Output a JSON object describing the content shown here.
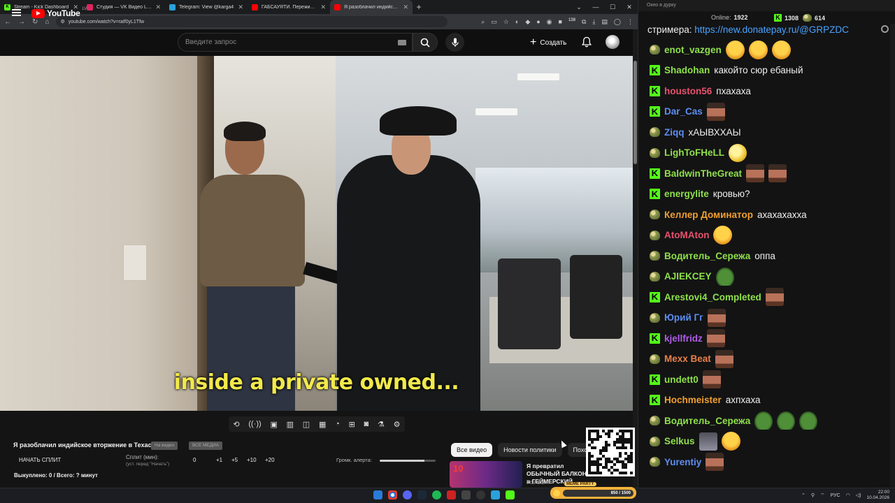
{
  "browser": {
    "tabs": [
      {
        "label": "Stream - Kick Dashboard",
        "fav_color": "#53fc18",
        "fav_text": "K"
      },
      {
        "label": "Студия — VK Видео Live",
        "fav_color": "#e0245e",
        "fav_text": ""
      },
      {
        "label": "Telegram: View @karga4",
        "fav_color": "#2aa1da",
        "fav_text": ""
      },
      {
        "label": "ГАБСАУЯТИ. Пережить индийск…",
        "fav_color": "#ff0000",
        "fav_text": ""
      },
      {
        "label": "Я разоблачил индийское…",
        "fav_color": "#ff0000",
        "fav_text": "",
        "active": true
      }
    ],
    "new_tab": "+",
    "url": "youtube.com/watch?v=raIf0yL1Tfw",
    "ext_badge": "138"
  },
  "youtube": {
    "logo_text": "YouTube",
    "country": "LV",
    "search_placeholder": "Введите запрос",
    "create_label": "Создать",
    "caption": "inside a private owned...",
    "video_title": "Я разоблачил индийское вторжение в Техас...",
    "pill_1": "На видео",
    "pill_2": "ВСЕ МЕДИА",
    "start_split": "НАЧАТЬ СПЛИТ",
    "split_label": "Сплит (мин):",
    "split_hint": "(уст. перед \"Начать\")",
    "split_value": "0",
    "inc": [
      "+1",
      "+5",
      "+10",
      "+20"
    ],
    "alert_volume": "Громк. алерта:",
    "alert_volume_level": 0.8,
    "totals": "Выкуплено: 0 / Всего: ? минут",
    "chips": [
      "Все видео",
      "Новости политики",
      "Похожие"
    ],
    "rec_number": "10",
    "rec_title": "Я превратил ОБЫЧНЫЙ БАЛКОН в ГЕЙМЕРСКИЙ",
    "rec_channel": "FISPECKT"
  },
  "chat": {
    "title": "Окно в дурку",
    "online_label": "Online:",
    "online_value": "1922",
    "kick_count": "1308",
    "other_count": "614",
    "intro_text": "стримера: ",
    "intro_link": "https://new.donatepay.ru/@GRPZDC",
    "messages": [
      {
        "badge": "f",
        "nick": "enot_vazgen",
        "color": "#8fe04a",
        "text": "",
        "emotes": [
          "laugh",
          "laugh",
          "laugh"
        ]
      },
      {
        "badge": "k",
        "nick": "Shadohan",
        "color": "#8fe04a",
        "text": "какойто сюр ебаный",
        "emotes": []
      },
      {
        "badge": "k",
        "nick": "houston56",
        "color": "#e8516d",
        "text": "пхахаха",
        "emotes": []
      },
      {
        "badge": "k",
        "nick": "Dar_Cas",
        "color": "#5d8ef0",
        "text": "",
        "emotes": [
          "man"
        ]
      },
      {
        "badge": "f",
        "nick": "Ziqq",
        "color": "#5d8ef0",
        "text": "хАЫВХХАЫ",
        "emotes": []
      },
      {
        "badge": "f",
        "nick": "LighToFHeLL",
        "color": "#8fe04a",
        "text": "",
        "emotes": [
          "moon"
        ]
      },
      {
        "badge": "k",
        "nick": "BaldwinTheGreat",
        "color": "#8fe04a",
        "text": "",
        "emotes": [
          "man",
          "man"
        ]
      },
      {
        "badge": "k",
        "nick": "energylite",
        "color": "#8fe04a",
        "text": "кровью?",
        "emotes": []
      },
      {
        "badge": "f",
        "nick": "Келлер Доминатор",
        "color": "#f0a030",
        "text": "ахахахахха",
        "emotes": []
      },
      {
        "badge": "f",
        "nick": "AtoMAton",
        "color": "#e8516d",
        "text": "",
        "emotes": [
          "laugh"
        ]
      },
      {
        "badge": "f",
        "nick": "Водитель_Сережа",
        "color": "#8fe04a",
        "text": "оппа",
        "emotes": []
      },
      {
        "badge": "f",
        "nick": "AJIEKCEY",
        "color": "#8fe04a",
        "text": "",
        "emotes": [
          "frog"
        ]
      },
      {
        "badge": "k",
        "nick": "Arestovi4_Completed",
        "color": "#8fe04a",
        "text": "",
        "emotes": [
          "man"
        ]
      },
      {
        "badge": "f",
        "nick": "Юрий Гг",
        "color": "#5d8ef0",
        "text": "",
        "emotes": [
          "man"
        ]
      },
      {
        "badge": "k",
        "nick": "kjellfridz",
        "color": "#b05de8",
        "text": "",
        "emotes": [
          "man"
        ]
      },
      {
        "badge": "f",
        "nick": "Mexx Beat",
        "color": "#e8804a",
        "text": "",
        "emotes": [
          "man"
        ]
      },
      {
        "badge": "k",
        "nick": "undett0",
        "color": "#8fe04a",
        "text": "",
        "emotes": [
          "man"
        ]
      },
      {
        "badge": "k",
        "nick": "Hochmeister",
        "color": "#f0a030",
        "text": "ахпхаха",
        "emotes": []
      },
      {
        "badge": "f",
        "nick": "Водитель_Сережа",
        "color": "#8fe04a",
        "text": "",
        "emotes": [
          "frog",
          "frog",
          "frog"
        ]
      },
      {
        "badge": "f",
        "nick": "Selkus",
        "color": "#8fe04a",
        "text": "",
        "emotes": [
          "bly",
          "laugh"
        ]
      },
      {
        "badge": "f",
        "nick": "Yurentiy",
        "color": "#5d8ef0",
        "text": "",
        "emotes": [
          "man"
        ]
      }
    ]
  },
  "taskbar": {
    "meme_tag": "MEME PARTY",
    "meme_progress": "850 / 1500",
    "lang": "РУС",
    "time": "22:00",
    "date": "10.04.2026"
  }
}
